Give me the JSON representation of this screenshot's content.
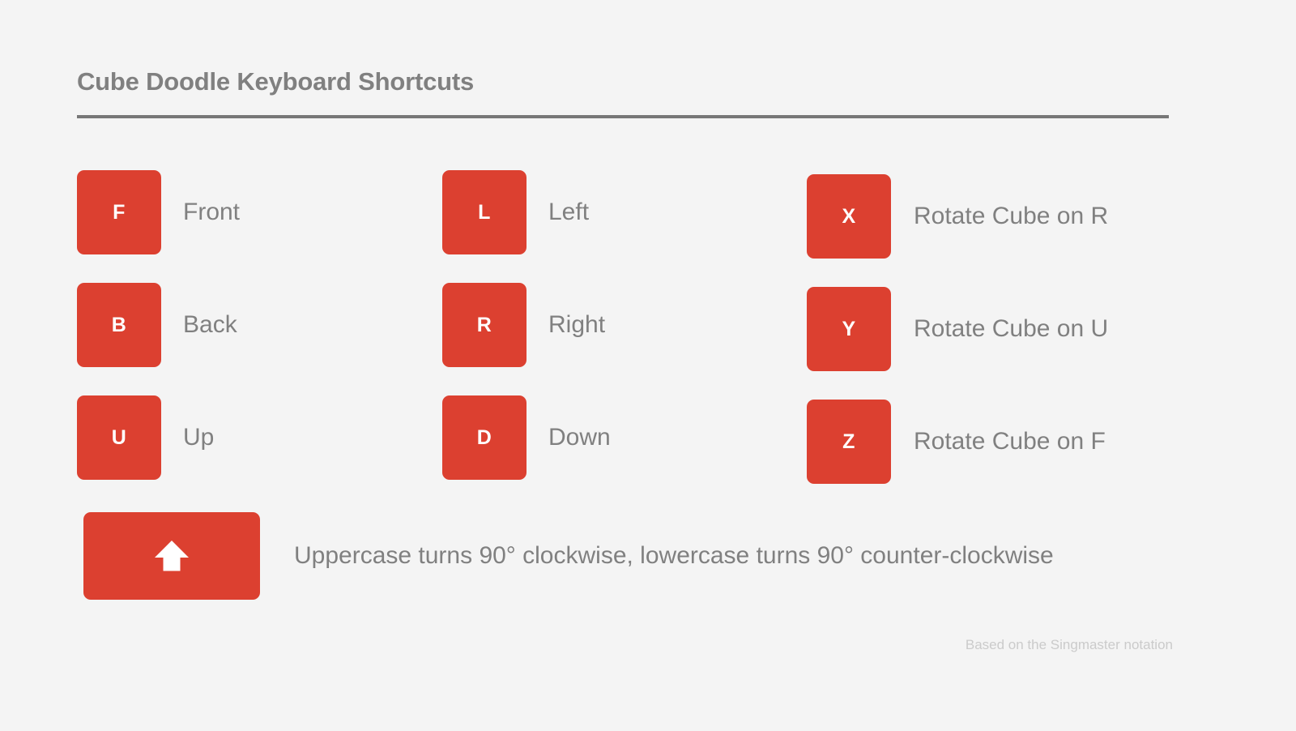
{
  "header": {
    "title": "Cube Doodle Keyboard Shortcuts"
  },
  "colors": {
    "background": "#f4f4f4",
    "key_red": "#dc4030",
    "key_text": "#ffffff",
    "label_gray": "#808080",
    "rule_gray": "#777777",
    "footer_gray": "#cbcbcb"
  },
  "shortcuts": {
    "column1": [
      {
        "key": "F",
        "label": "Front"
      },
      {
        "key": "B",
        "label": "Back"
      },
      {
        "key": "U",
        "label": "Up"
      }
    ],
    "column2": [
      {
        "key": "L",
        "label": "Left"
      },
      {
        "key": "R",
        "label": "Right"
      },
      {
        "key": "D",
        "label": "Down"
      }
    ],
    "column3": [
      {
        "key": "X",
        "label": "Rotate Cube on R"
      },
      {
        "key": "Y",
        "label": "Rotate Cube on U"
      },
      {
        "key": "Z",
        "label": "Rotate Cube on F"
      }
    ]
  },
  "shift": {
    "icon": "shift-up-arrow-icon",
    "note": "Uppercase turns 90° clockwise, lowercase turns 90° counter-clockwise"
  },
  "footer": {
    "note": "Based on the Singmaster notation"
  }
}
